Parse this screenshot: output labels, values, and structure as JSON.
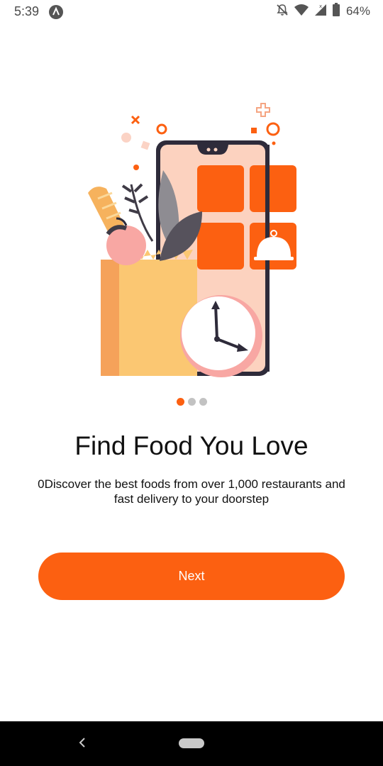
{
  "status_bar": {
    "time": "5:39",
    "battery": "64%",
    "icons": [
      "app-notification-icon",
      "notifications-off-icon",
      "wifi-icon",
      "signal-icon",
      "battery-icon"
    ]
  },
  "onboarding": {
    "pages": 3,
    "active_page": 1,
    "title": "Find Food You Love",
    "description": "0Discover the best foods from over 1,000 restaurants and fast delivery to your doorstep",
    "next_label": "Next"
  },
  "colors": {
    "accent": "#fc6011",
    "dot_inactive": "#c2c2c2",
    "text": "#111111"
  },
  "nav_bar": {
    "icons": [
      "back-icon",
      "home-pill-icon"
    ]
  }
}
